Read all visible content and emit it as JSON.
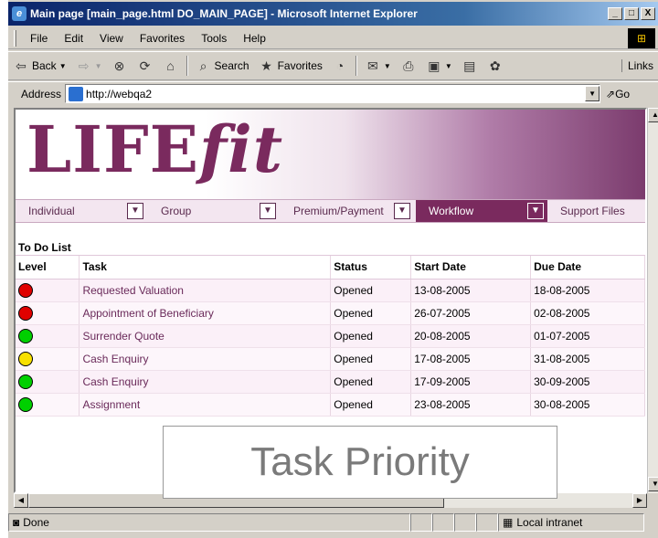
{
  "window": {
    "title": "Main page [main_page.html DO_MAIN_PAGE] - Microsoft Internet Explorer",
    "min": "_",
    "max": "□",
    "close": "X"
  },
  "menu": [
    "File",
    "Edit",
    "View",
    "Favorites",
    "Tools",
    "Help"
  ],
  "toolbar": {
    "back": "Back",
    "search": "Search",
    "favorites": "Favorites",
    "links": "Links"
  },
  "address": {
    "label": "Address",
    "value": "http://webqa2",
    "go": "Go"
  },
  "nav": [
    "Individual",
    "Group",
    "Premium/Payment",
    "Workflow",
    "Support Files"
  ],
  "nav_active": "Workflow",
  "logo": {
    "part1": "LIFE",
    "part2": "fit"
  },
  "todo": {
    "title": "To Do List",
    "headers": [
      "Level",
      "Task",
      "Status",
      "Start Date",
      "Due Date"
    ],
    "rows": [
      {
        "level": "red",
        "task": "Requested Valuation",
        "status": "Opened",
        "start": "13-08-2005",
        "due": "18-08-2005"
      },
      {
        "level": "red",
        "task": "Appointment of Beneficiary",
        "status": "Opened",
        "start": "26-07-2005",
        "due": "02-08-2005"
      },
      {
        "level": "green",
        "task": "Surrender Quote",
        "status": "Opened",
        "start": "20-08-2005",
        "due": "01-07-2005"
      },
      {
        "level": "yellow",
        "task": "Cash Enquiry",
        "status": "Opened",
        "start": "17-08-2005",
        "due": "31-08-2005"
      },
      {
        "level": "green",
        "task": "Cash Enquiry",
        "status": "Opened",
        "start": "17-09-2005",
        "due": "30-09-2005"
      },
      {
        "level": "green",
        "task": "Assignment",
        "status": "Opened",
        "start": "23-08-2005",
        "due": "30-08-2005"
      }
    ]
  },
  "colors": {
    "red": "#e00000",
    "green": "#00d000",
    "yellow": "#f8e000",
    "brand": "#7a2a5e"
  },
  "overlay": "Task Priority",
  "status": {
    "left": "Done",
    "zone": "Local intranet"
  }
}
